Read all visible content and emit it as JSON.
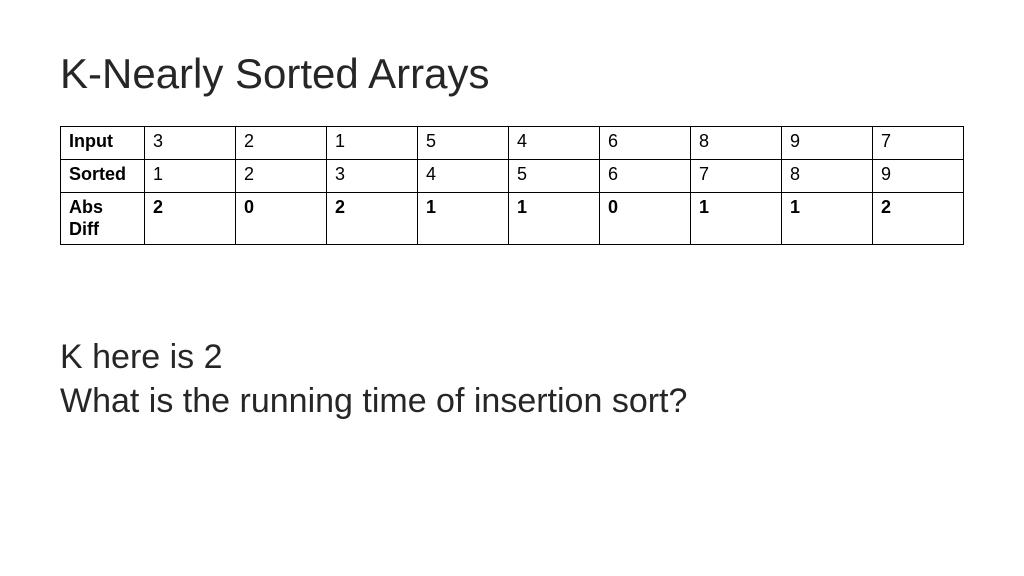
{
  "title": "K-Nearly Sorted Arrays",
  "rows": {
    "input": {
      "label": "Input",
      "values": [
        "3",
        "2",
        "1",
        "5",
        "4",
        "6",
        "8",
        "9",
        "7"
      ]
    },
    "sorted": {
      "label": "Sorted",
      "values": [
        "1",
        "2",
        "3",
        "4",
        "5",
        "6",
        "7",
        "8",
        "9"
      ]
    },
    "diff": {
      "label": "Abs Diff",
      "values": [
        "2",
        "0",
        "2",
        "1",
        "1",
        "0",
        "1",
        "1",
        "2"
      ]
    }
  },
  "body": {
    "line1": "K here is 2",
    "line2": "What is the running time of insertion sort?"
  },
  "chart_data": {
    "type": "table",
    "title": "K-Nearly Sorted Arrays",
    "rows": [
      {
        "label": "Input",
        "values": [
          3,
          2,
          1,
          5,
          4,
          6,
          8,
          9,
          7
        ]
      },
      {
        "label": "Sorted",
        "values": [
          1,
          2,
          3,
          4,
          5,
          6,
          7,
          8,
          9
        ]
      },
      {
        "label": "Abs Diff",
        "values": [
          2,
          0,
          2,
          1,
          1,
          0,
          1,
          1,
          2
        ]
      }
    ],
    "k": 2
  }
}
